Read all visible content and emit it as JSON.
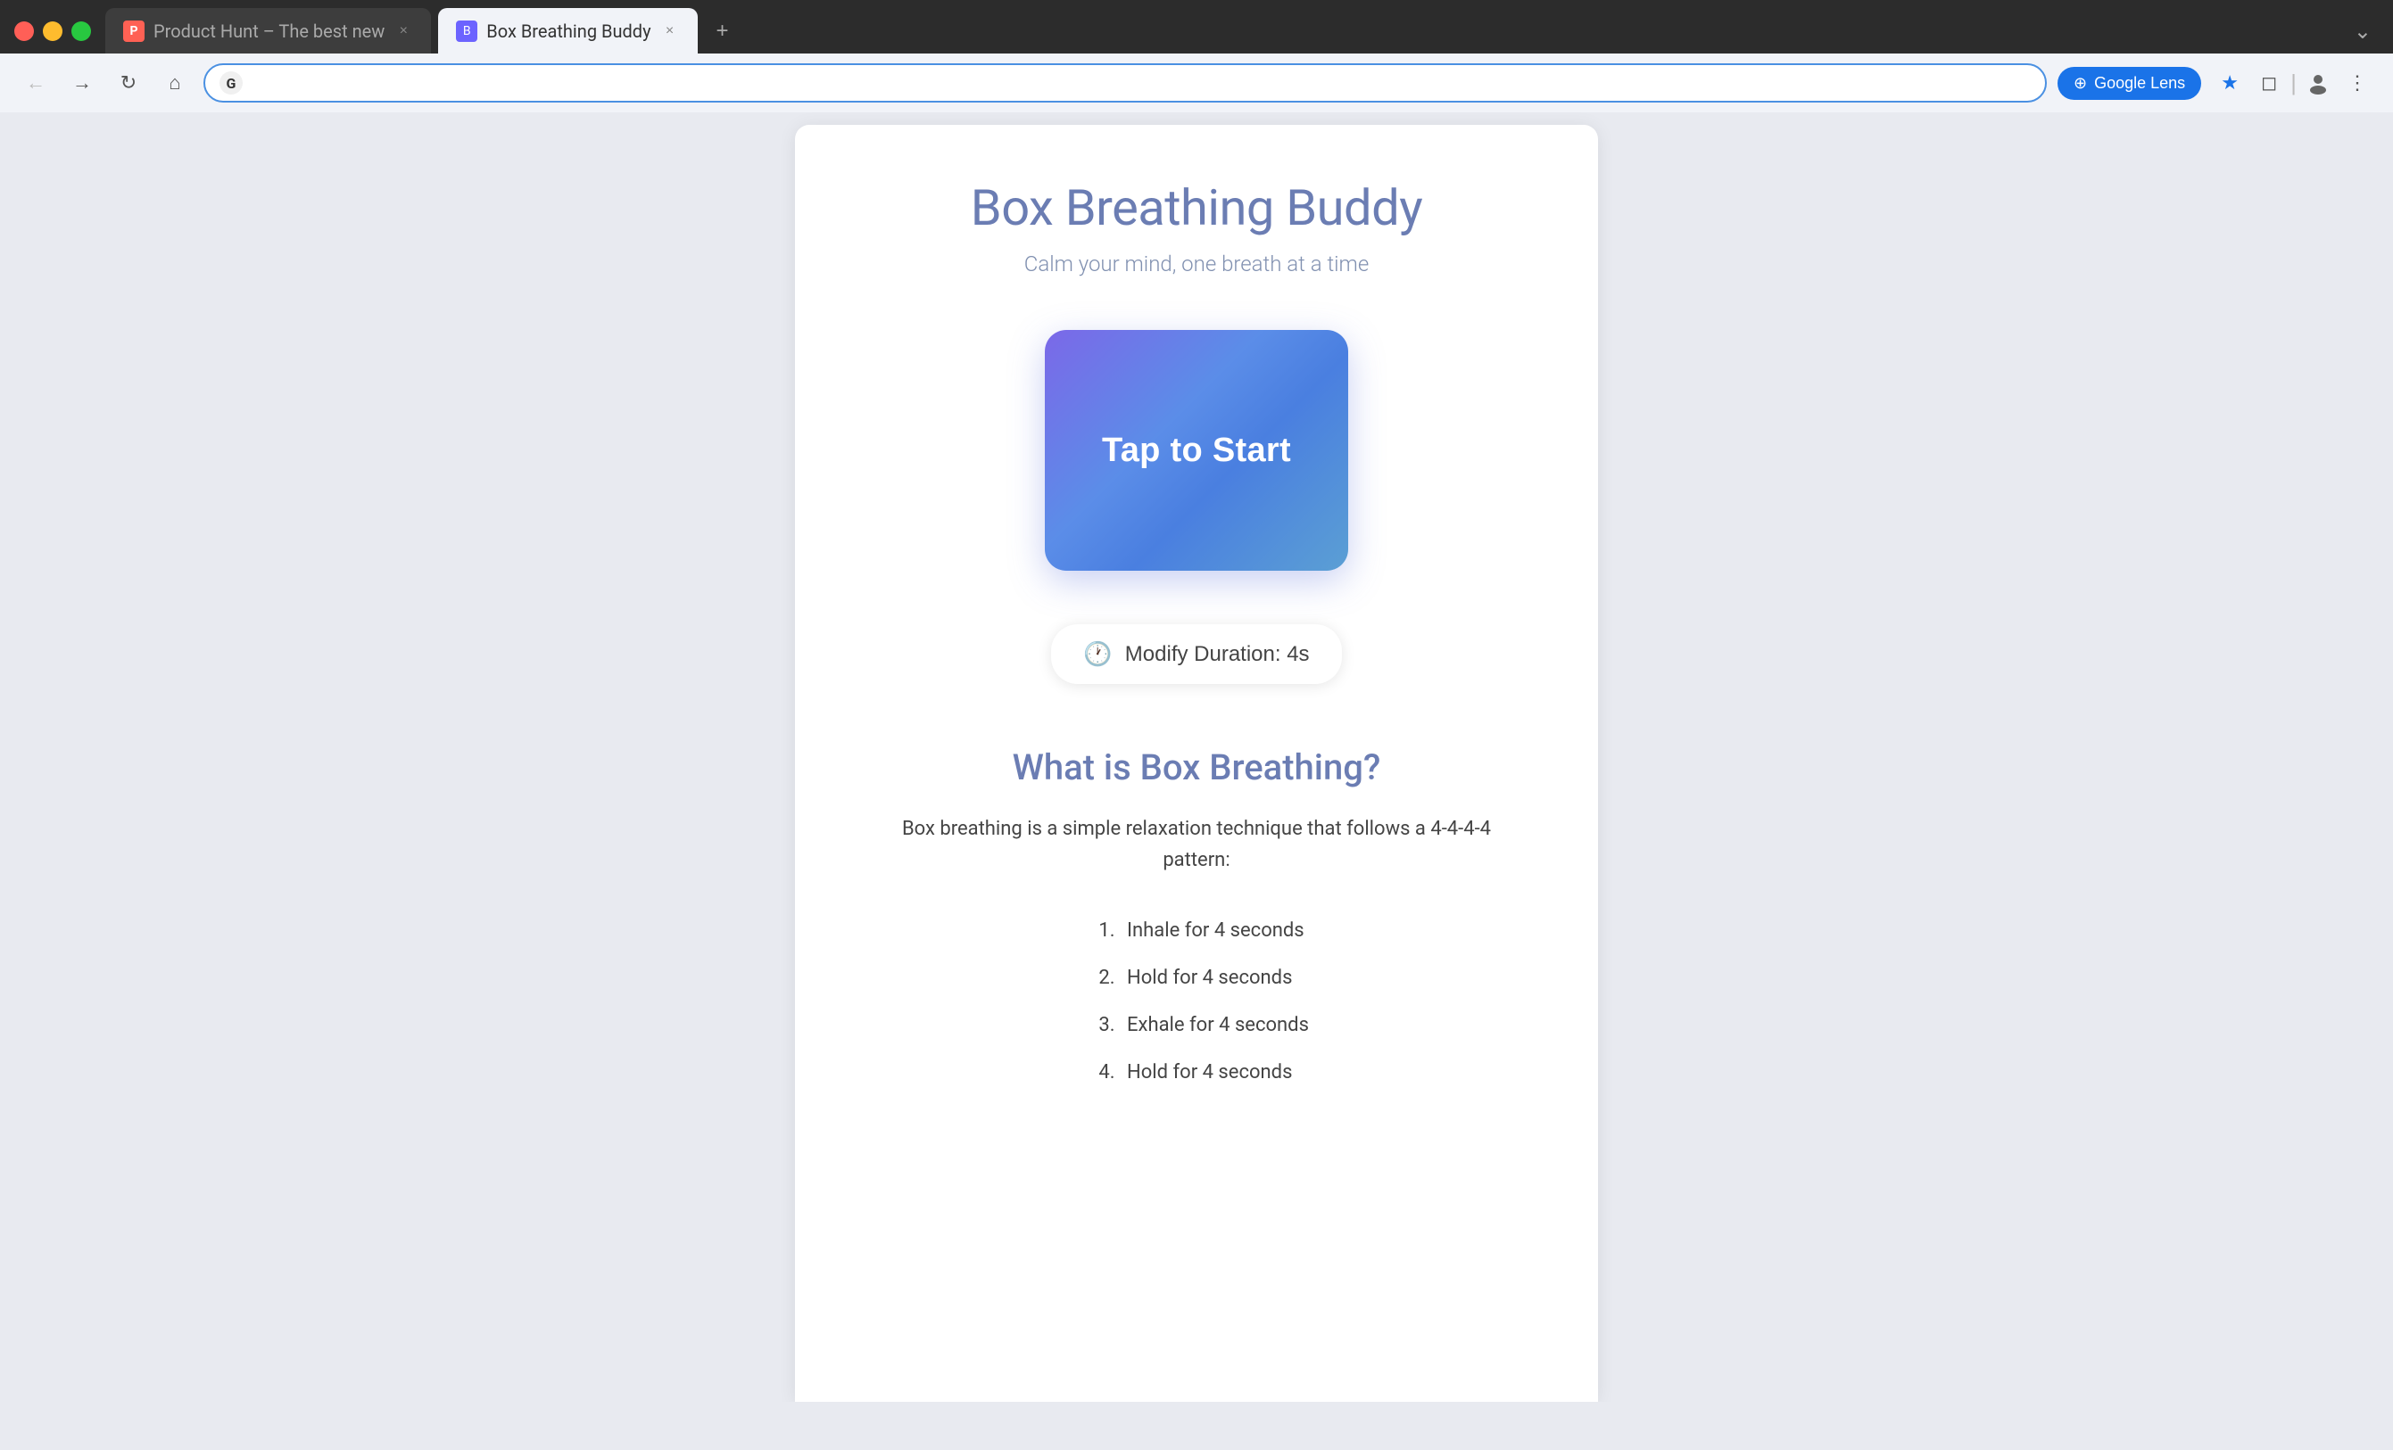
{
  "browser": {
    "window_controls": {
      "close_label": "×",
      "minimize_label": "−",
      "maximize_label": "+"
    },
    "tabs": [
      {
        "id": "tab-producthunt",
        "favicon_letter": "P",
        "label": "Product Hunt – The best new",
        "active": false
      },
      {
        "id": "tab-breathing",
        "favicon_letter": "B",
        "label": "Box Breathing Buddy",
        "active": true
      }
    ],
    "tab_add_label": "+",
    "tab_chevron_label": "⌄",
    "toolbar": {
      "back_label": "←",
      "forward_label": "→",
      "reload_label": "↻",
      "home_label": "⌂",
      "address_favicon": "G",
      "address_value": "",
      "google_lens_label": "Google Lens",
      "star_label": "★",
      "extensions_label": "◻",
      "divider": "|",
      "profile_label": "👤",
      "menu_label": "⋮"
    }
  },
  "page": {
    "title": "Box Breathing Buddy",
    "subtitle": "Calm your mind, one breath at a time",
    "start_button_label": "Tap to Start",
    "modify_duration_label": "Modify Duration: 4s",
    "what_is_title": "What is Box Breathing?",
    "what_is_desc": "Box breathing is a simple relaxation technique that follows a 4-4-4-4 pattern:",
    "steps": [
      "Inhale for 4 seconds",
      "Hold for 4 seconds",
      "Exhale for 4 seconds",
      "Hold for 4 seconds"
    ]
  },
  "colors": {
    "tab_active_bg": "#f1f3f8",
    "tab_inactive_bg": "#3d3d3d",
    "start_gradient_start": "#7b68e8",
    "start_gradient_end": "#5b9fd4",
    "title_color": "#6b7db3",
    "subtitle_color": "#8090b0"
  }
}
